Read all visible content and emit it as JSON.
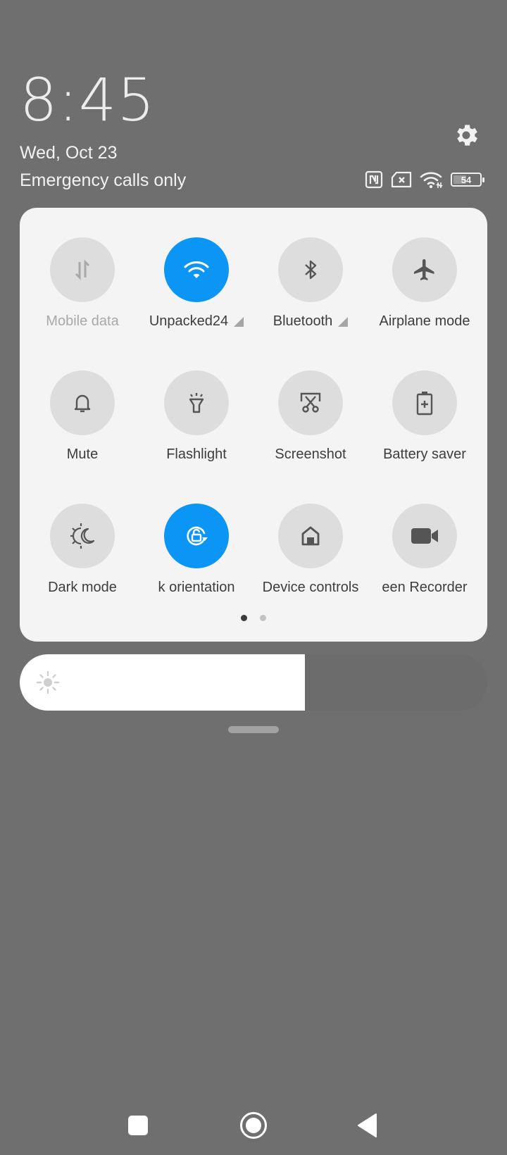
{
  "header": {
    "time": "8:45",
    "date": "Wed, Oct 23",
    "carrier_status": "Emergency calls only",
    "settings_icon": "gear-icon",
    "status_icons": [
      "nfc-icon",
      "no-sim-icon",
      "wifi-icon",
      "battery-icon"
    ],
    "battery_level": "54",
    "battery_fraction": 0.54
  },
  "quick_settings": {
    "tiles": [
      {
        "label": "Mobile data",
        "icon": "mobile-data-icon",
        "state": "disabled",
        "has_expand": false
      },
      {
        "label": "Unpacked24",
        "icon": "wifi-icon",
        "state": "on",
        "has_expand": true
      },
      {
        "label": "Bluetooth",
        "icon": "bluetooth-icon",
        "state": "off",
        "has_expand": true
      },
      {
        "label": "Airplane mode",
        "icon": "airplane-icon",
        "state": "off",
        "has_expand": false
      },
      {
        "label": "Mute",
        "icon": "bell-icon",
        "state": "off",
        "has_expand": false
      },
      {
        "label": "Flashlight",
        "icon": "flashlight-icon",
        "state": "off",
        "has_expand": false
      },
      {
        "label": "Screenshot",
        "icon": "screenshot-icon",
        "state": "off",
        "has_expand": false
      },
      {
        "label": "Battery saver",
        "icon": "battery-saver-icon",
        "state": "off",
        "has_expand": false
      },
      {
        "label": "Dark mode",
        "icon": "dark-mode-icon",
        "state": "off",
        "has_expand": false
      },
      {
        "label": "Lock orientation",
        "visible_label": "k orientation",
        "icon": "rotation-lock-icon",
        "state": "on",
        "has_expand": false
      },
      {
        "label": "Device controls",
        "icon": "home-icon",
        "state": "off",
        "has_expand": false
      },
      {
        "label": "Screen Recorder",
        "visible_label": "een Recorder",
        "icon": "video-camera-icon",
        "state": "off",
        "has_expand": false
      }
    ],
    "page_count": 2,
    "current_page": 1
  },
  "brightness": {
    "icon": "sun-icon",
    "level_fraction": 0.61
  },
  "navigation": {
    "recents": "recents-square-icon",
    "home": "home-circle-icon",
    "back": "back-triangle-icon"
  },
  "colors": {
    "background": "#6f6f6f",
    "panel": "#f4f4f4",
    "tile_off": "#dddddd",
    "tile_on": "#0b96f5",
    "icon_gray": "#5a5a5a"
  }
}
